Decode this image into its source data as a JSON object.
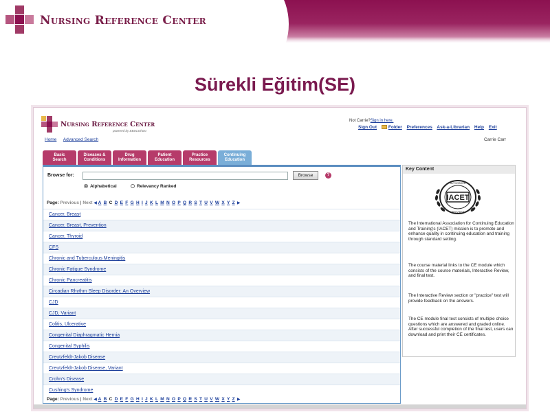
{
  "slide": {
    "brand": "Nursing Reference Center",
    "title": "Sürekli Eğitim(SE)",
    "colors": {
      "accent": "#8c1150",
      "tab": "#b63b6a",
      "tab_active": "#7aaed8"
    }
  },
  "app": {
    "logo_text": "Nursing Reference Center",
    "powered_by": "powered by EBSCOhost",
    "not_user_prefix": "Not Carrie?",
    "not_user_link": "Sign in here.",
    "toplinks": [
      "Sign Out",
      "Folder",
      "Preferences",
      "Ask-a-Librarian",
      "Help",
      "Exit"
    ],
    "sublinks": [
      "Home",
      "Advanced Search"
    ],
    "username": "Carrie Carr",
    "tabs": [
      {
        "label": "Basic\nSearch"
      },
      {
        "label": "Diseases &\nConditions"
      },
      {
        "label": "Drug\nInformation"
      },
      {
        "label": "Patient\nEducation"
      },
      {
        "label": "Practice\nResources"
      },
      {
        "label": "Continuing\nEducation"
      }
    ]
  },
  "browse": {
    "label": "Browse for:",
    "value": "",
    "button": "Browse",
    "help": "?",
    "options": [
      "Alphabetical",
      "Relevancy Ranked"
    ],
    "selected_option": "Alphabetical"
  },
  "pager": {
    "page_label": "Page:",
    "previous": "Previous",
    "separator": "|",
    "next": "Next",
    "letters": [
      "A",
      "B",
      "C",
      "D",
      "E",
      "F",
      "G",
      "H",
      "I",
      "J",
      "K",
      "L",
      "M",
      "N",
      "O",
      "P",
      "Q",
      "R",
      "S",
      "T",
      "U",
      "V",
      "W",
      "X",
      "Y",
      "Z"
    ],
    "current": "C"
  },
  "results": [
    "Cancer, Breast",
    "Cancer, Breast, Prevention",
    "Cancer, Thyroid",
    "CFS",
    "Chronic and Tuberculous Meningitis",
    "Chronic Fatigue Syndrome",
    "Chronic Pancreatitis",
    "Circadian Rhythm Sleep Disorder: An Overview",
    "CJD",
    "CJD, Variant",
    "Colitis, Ulcerative",
    "Congenital Diaphragmatic Hernia",
    "Congenital Syphilis",
    "Creutzfeldt-Jakob Disease",
    "Creutzfeldt-Jakob Disease, Variant",
    "Crohn's Disease",
    "Cushing's Syndrome"
  ],
  "key_content": {
    "heading": "Key Content",
    "logo_text": "IACET",
    "logo_ring_top": "AUTHORIZED",
    "logo_ring_bottom": "PROVIDER",
    "paragraphs": [
      "The International Association for Continuing Education and Training's (IACET) mission is to promote and enhance quality in continuing education and training through standard setting.",
      "The course material links to the CE module which consists of the course materials, Interactive Review, and final test.",
      "The Interactive Review section or \"practice\" test will provide feedback on the answers.",
      "The CE module final test consists of multiple choice questions which are answered and graded online. After successful completion of the final test, users can download and print their CE certificates."
    ]
  }
}
